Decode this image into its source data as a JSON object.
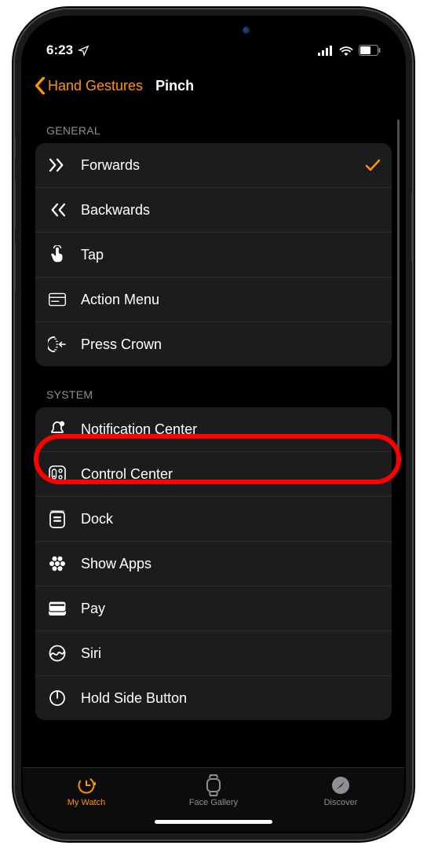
{
  "status": {
    "time": "6:23",
    "location_icon": "location-arrow",
    "signal": 4,
    "wifi": 3,
    "battery_pct": 55
  },
  "nav": {
    "back_label": "Hand Gestures",
    "title": "Pinch"
  },
  "sections": [
    {
      "header": "GENERAL",
      "rows": [
        {
          "icon": "forwards-icon",
          "label": "Forwards",
          "selected": true
        },
        {
          "icon": "backwards-icon",
          "label": "Backwards",
          "selected": false
        },
        {
          "icon": "tap-icon",
          "label": "Tap",
          "selected": false
        },
        {
          "icon": "action-menu-icon",
          "label": "Action Menu",
          "selected": false
        },
        {
          "icon": "press-crown-icon",
          "label": "Press Crown",
          "selected": false,
          "highlighted": true
        }
      ]
    },
    {
      "header": "SYSTEM",
      "rows": [
        {
          "icon": "notification-center-icon",
          "label": "Notification Center"
        },
        {
          "icon": "control-center-icon",
          "label": "Control Center"
        },
        {
          "icon": "dock-icon",
          "label": "Dock"
        },
        {
          "icon": "show-apps-icon",
          "label": "Show Apps"
        },
        {
          "icon": "apple-pay-icon",
          "label": "Pay",
          "prefix_apple_logo": true
        },
        {
          "icon": "siri-icon",
          "label": "Siri"
        },
        {
          "icon": "hold-side-button-icon",
          "label": "Hold Side Button"
        }
      ]
    }
  ],
  "tabs": [
    {
      "icon": "my-watch-tab-icon",
      "label": "My Watch",
      "active": true
    },
    {
      "icon": "face-gallery-tab-icon",
      "label": "Face Gallery",
      "active": false
    },
    {
      "icon": "discover-tab-icon",
      "label": "Discover",
      "active": false
    }
  ]
}
